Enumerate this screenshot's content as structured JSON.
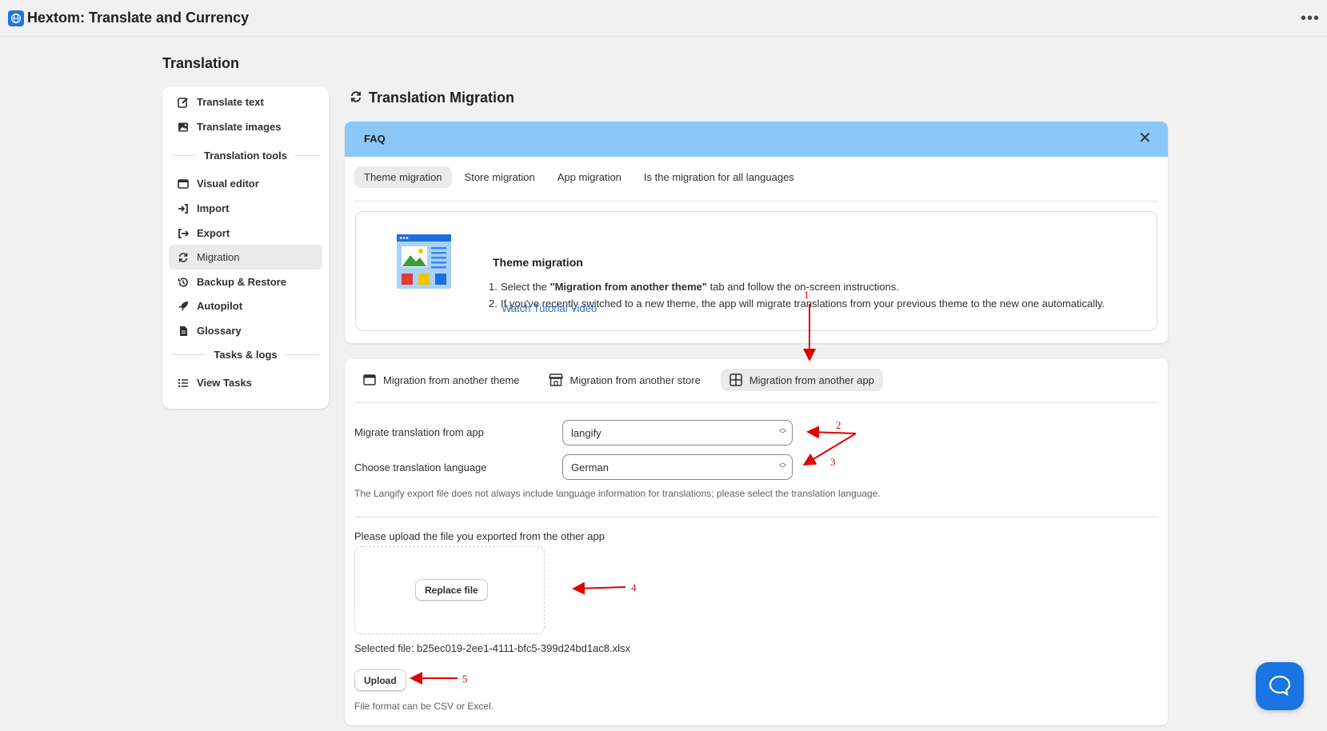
{
  "app": {
    "title": "Hextom: Translate and Currency"
  },
  "page": {
    "title": "Translation"
  },
  "sidebar": {
    "items": [
      {
        "label": "Translate text",
        "icon": "edit-icon"
      },
      {
        "label": "Translate images",
        "icon": "image-icon"
      },
      {
        "label": "Visual editor",
        "icon": "window-icon"
      },
      {
        "label": "Import",
        "icon": "import-icon"
      },
      {
        "label": "Export",
        "icon": "export-icon"
      },
      {
        "label": "Migration",
        "icon": "refresh-icon",
        "active": true
      },
      {
        "label": "Backup & Restore",
        "icon": "history-icon"
      },
      {
        "label": "Autopilot",
        "icon": "rocket-icon"
      },
      {
        "label": "Glossary",
        "icon": "document-icon"
      },
      {
        "label": "View Tasks",
        "icon": "list-icon"
      }
    ],
    "sections": {
      "tools": "Translation tools",
      "tasks": "Tasks & logs"
    }
  },
  "main": {
    "title": "Translation Migration",
    "faq": {
      "label": "FAQ",
      "tabs": [
        "Theme migration",
        "Store migration",
        "App migration",
        "Is the migration for all languages"
      ],
      "active_tab": "Theme migration",
      "content": {
        "title": "Theme migration",
        "step1_prefix": "Select the ",
        "step1_bold": "\"Migration from another theme\"",
        "step1_suffix": " tab and follow the on-screen instructions.",
        "step2": "If you've recently switched to a new theme, the app will migrate translations from your previous theme to the new one automatically.",
        "link": "Watch Tutorial Video"
      }
    },
    "migration": {
      "tabs": [
        "Migration from another theme",
        "Migration from another store",
        "Migration from another app"
      ],
      "active_tab": "Migration from another app",
      "app_label": "Migrate translation from app",
      "app_value": "langify",
      "lang_label": "Choose translation language",
      "lang_value": "German",
      "hint": "The Langify export file does not always include language information for translations; please select the translation language.",
      "upload_label": "Please upload the file you exported from the other app",
      "replace_button": "Replace file",
      "selected_file": "Selected file: b25ec019-2ee1-4111-bfc5-399d24bd1ac8.xlsx",
      "upload_button": "Upload",
      "format_hint": "File format can be CSV or Excel."
    }
  },
  "annotations": [
    "1",
    "2",
    "3",
    "4",
    "5"
  ],
  "colors": {
    "faq_bar": "#8cc8f7",
    "link": "#2c6ecb",
    "accent": "#1b74e4",
    "annotation": "#e00000"
  }
}
